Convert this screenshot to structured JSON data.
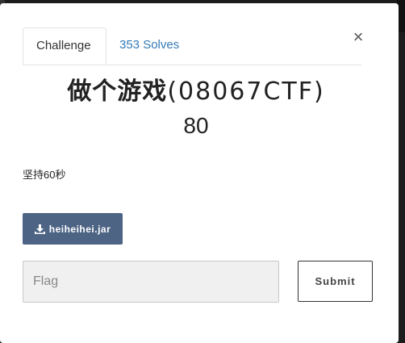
{
  "tabs": {
    "challenge_label": "Challenge",
    "solves_label": "353 Solves"
  },
  "close_label": "×",
  "challenge": {
    "name_cjk": "做个游戏",
    "name_ascii": "(08067CTF)",
    "points": "80",
    "description": "坚持60秒"
  },
  "file": {
    "icon": "download-icon",
    "name": "heiheihei.jar"
  },
  "flag": {
    "placeholder": "Flag",
    "value": ""
  },
  "submit_label": "Submit",
  "colors": {
    "file_button": "#4d6485",
    "link": "#337ab7",
    "input_bg": "#f0f0f0"
  }
}
